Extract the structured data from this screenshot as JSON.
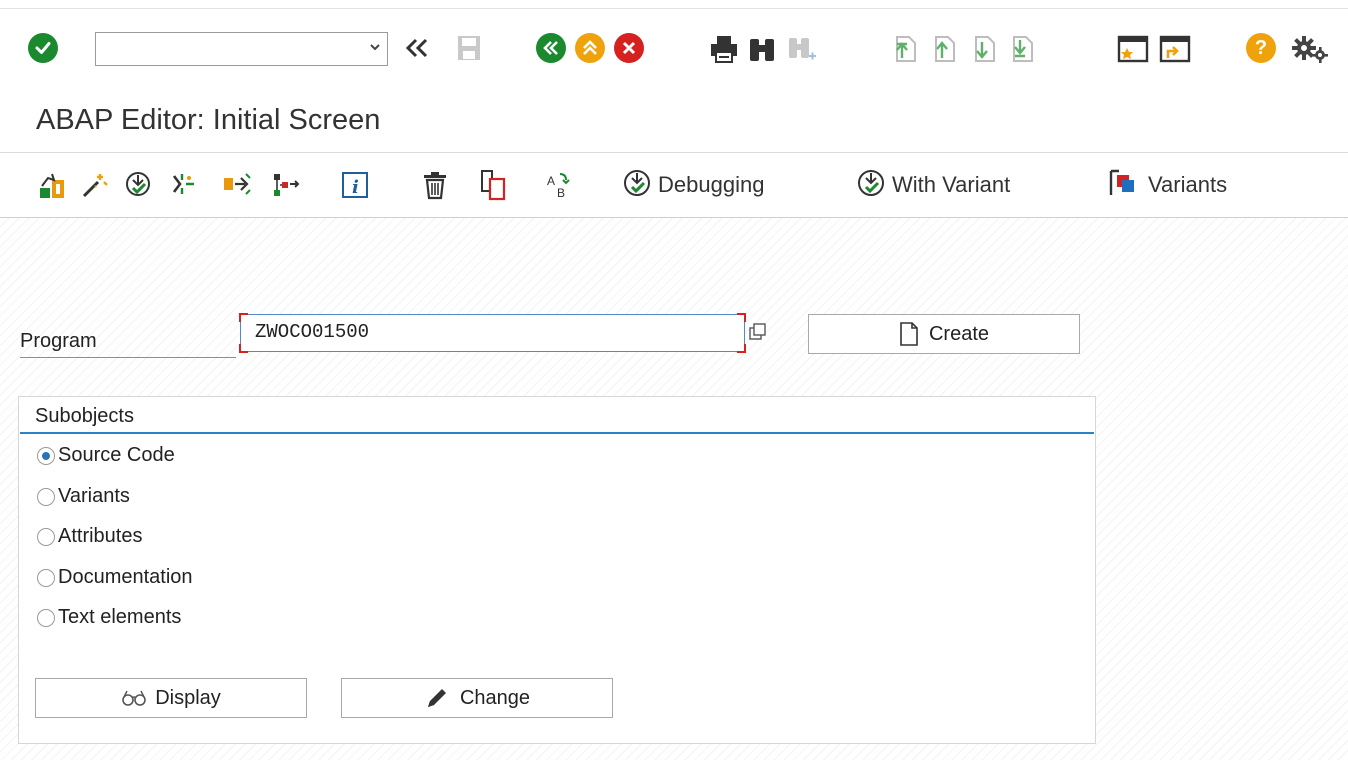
{
  "systoolbar": {
    "command_value": "",
    "icons": [
      "enter-icon",
      "back-double-icon",
      "save-icon",
      "back-icon",
      "exit-icon",
      "cancel-icon",
      "print-icon",
      "find-icon",
      "find-next-icon",
      "first-page-icon",
      "previous-page-icon",
      "next-page-icon",
      "last-page-icon",
      "new-session-icon",
      "shortcut-icon",
      "help-icon",
      "settings-icon"
    ]
  },
  "title": "ABAP Editor: Initial Screen",
  "apptoolbar": {
    "debugging_label": "Debugging",
    "with_variant_label": "With Variant",
    "variants_label": "Variants"
  },
  "form": {
    "program_label": "Program",
    "program_value": "ZWOCO01500",
    "create_label": "Create"
  },
  "subobjects": {
    "title": "Subobjects",
    "options": [
      {
        "label": "Source Code",
        "checked": true
      },
      {
        "label": "Variants",
        "checked": false
      },
      {
        "label": "Attributes",
        "checked": false
      },
      {
        "label": "Documentation",
        "checked": false
      },
      {
        "label": "Text elements",
        "checked": false
      }
    ],
    "display_label": "Display",
    "change_label": "Change"
  },
  "colors": {
    "accent_blue": "#2a84c6",
    "green": "#1b8a2e",
    "orange": "#f0a20c",
    "red": "#d62121"
  }
}
